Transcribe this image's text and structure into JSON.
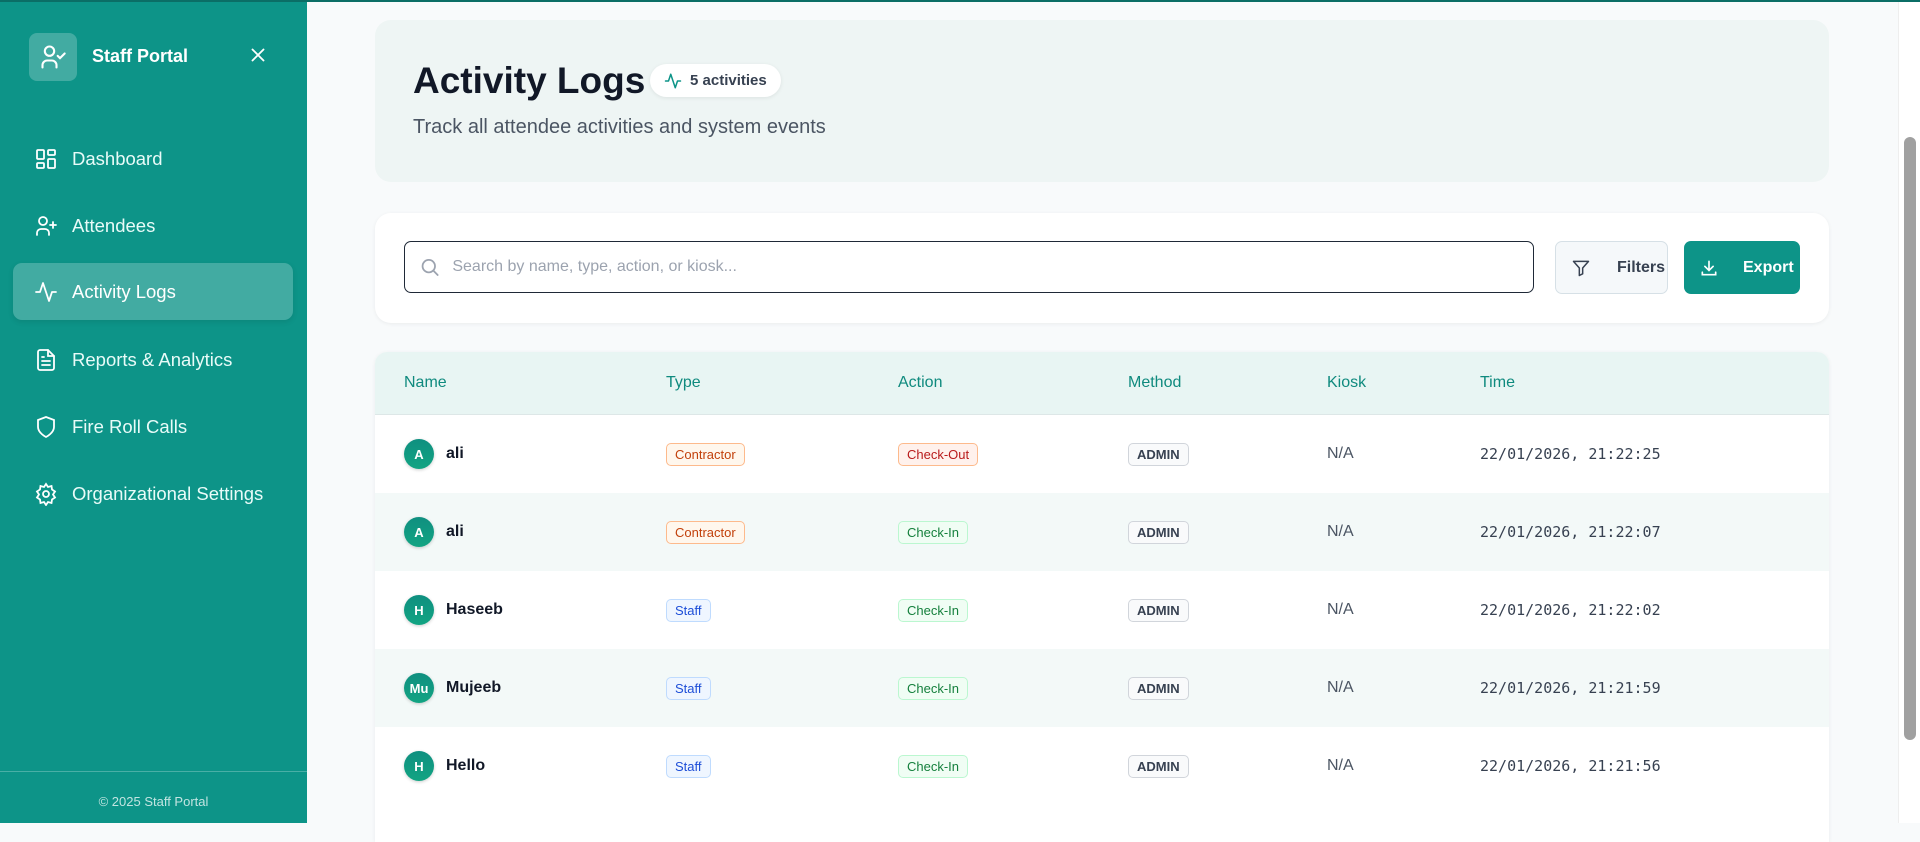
{
  "sidebar": {
    "brand": "Staff Portal",
    "items": [
      {
        "label": "Dashboard",
        "icon": "dashboard-icon"
      },
      {
        "label": "Attendees",
        "icon": "user-plus-icon"
      },
      {
        "label": "Activity Logs",
        "icon": "activity-icon",
        "active": true
      },
      {
        "label": "Reports & Analytics",
        "icon": "file-text-icon"
      },
      {
        "label": "Fire Roll Calls",
        "icon": "shield-icon"
      },
      {
        "label": "Organizational Settings",
        "icon": "gear-icon"
      }
    ],
    "footer": "© 2025 Staff Portal"
  },
  "header": {
    "title": "Activity Logs",
    "badge": "5 activities",
    "subtitle": "Track all attendee activities and system events"
  },
  "toolbar": {
    "search_placeholder": "Search by name, type, action, or kiosk...",
    "search_value": "",
    "filters": "Filters",
    "export": "Export"
  },
  "table": {
    "columns": [
      "Name",
      "Type",
      "Action",
      "Method",
      "Kiosk",
      "Time"
    ],
    "rows": [
      {
        "initial": "A",
        "name": "ali",
        "type": "Contractor",
        "action": "Check-Out",
        "method": "ADMIN",
        "kiosk": "N/A",
        "time": "22/01/2026, 21:22:25"
      },
      {
        "initial": "A",
        "name": "ali",
        "type": "Contractor",
        "action": "Check-In",
        "method": "ADMIN",
        "kiosk": "N/A",
        "time": "22/01/2026, 21:22:07"
      },
      {
        "initial": "H",
        "name": "Haseeb",
        "type": "Staff",
        "action": "Check-In",
        "method": "ADMIN",
        "kiosk": "N/A",
        "time": "22/01/2026, 21:22:02"
      },
      {
        "initial": "Mu",
        "name": "Mujeeb",
        "type": "Staff",
        "action": "Check-In",
        "method": "ADMIN",
        "kiosk": "N/A",
        "time": "22/01/2026, 21:21:59"
      },
      {
        "initial": "H",
        "name": "Hello",
        "type": "Staff",
        "action": "Check-In",
        "method": "ADMIN",
        "kiosk": "N/A",
        "time": "22/01/2026, 21:21:56"
      }
    ]
  },
  "colors": {
    "primary": "#0d9488",
    "header_text": "#0f8a7e"
  }
}
